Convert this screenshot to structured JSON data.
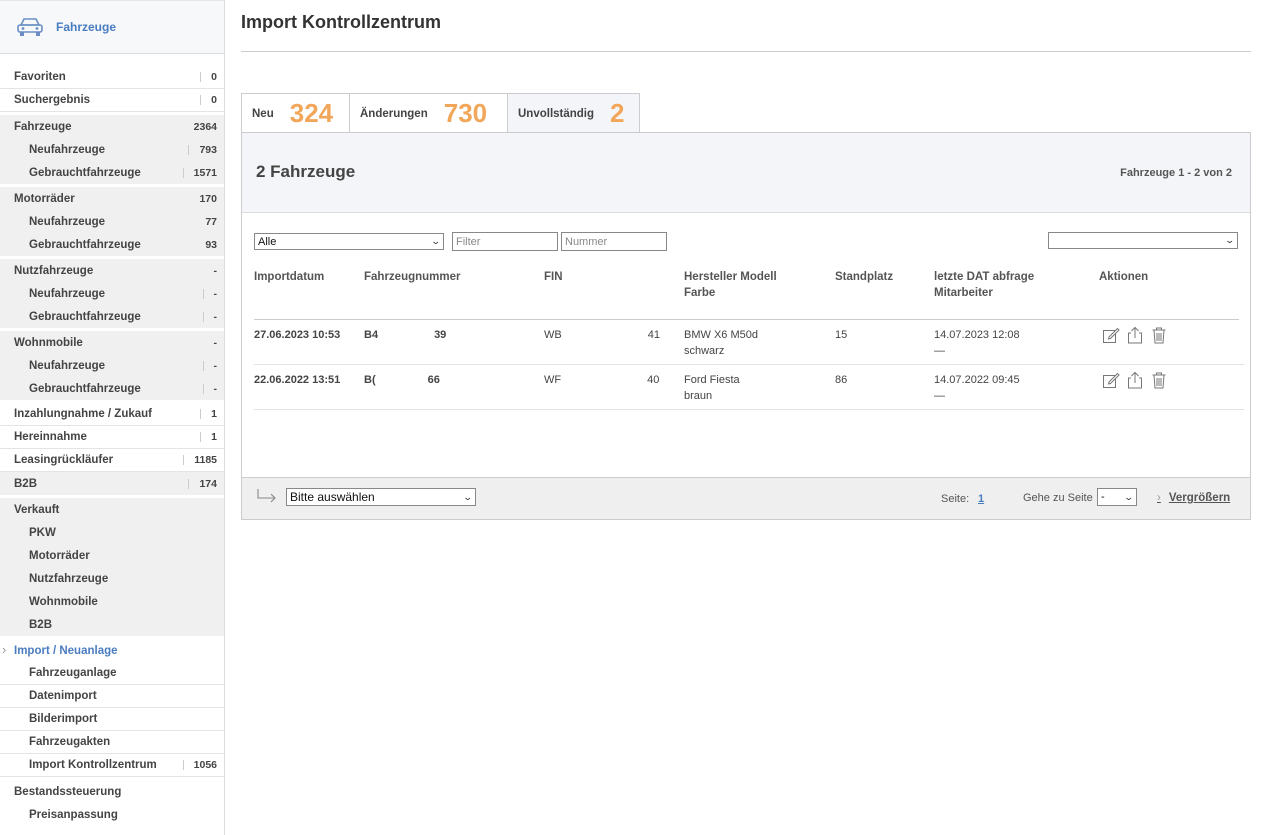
{
  "sidebar": {
    "header_title": "Fahrzeuge",
    "items": [
      {
        "label": "Favoriten",
        "count": "0",
        "level": 0,
        "style": "sep",
        "bar": true
      },
      {
        "label": "Suchergebnis",
        "count": "0",
        "level": 0,
        "style": "sep",
        "bar": true
      },
      {
        "label": "Fahrzeuge",
        "count": "2364",
        "level": 0,
        "style": "grey",
        "bar": false
      },
      {
        "label": "Neufahrzeuge",
        "count": "793",
        "level": 1,
        "style": "grey",
        "bar": true
      },
      {
        "label": "Gebrauchtfahrzeuge",
        "count": "1571",
        "level": 1,
        "style": "grey",
        "bar": true
      },
      {
        "label": "Motorräder",
        "count": "170",
        "level": 0,
        "style": "grey",
        "bar": false
      },
      {
        "label": "Neufahrzeuge",
        "count": "77",
        "level": 1,
        "style": "grey",
        "bar": false
      },
      {
        "label": "Gebrauchtfahrzeuge",
        "count": "93",
        "level": 1,
        "style": "grey",
        "bar": false
      },
      {
        "label": "Nutzfahrzeuge",
        "count": "-",
        "level": 0,
        "style": "grey",
        "bar": false
      },
      {
        "label": "Neufahrzeuge",
        "count": "-",
        "level": 1,
        "style": "grey",
        "bar": true
      },
      {
        "label": "Gebrauchtfahrzeuge",
        "count": "-",
        "level": 1,
        "style": "grey",
        "bar": true
      },
      {
        "label": "Wohnmobile",
        "count": "-",
        "level": 0,
        "style": "grey",
        "bar": false
      },
      {
        "label": "Neufahrzeuge",
        "count": "-",
        "level": 1,
        "style": "grey",
        "bar": true
      },
      {
        "label": "Gebrauchtfahrzeuge",
        "count": "-",
        "level": 1,
        "style": "grey",
        "bar": true
      },
      {
        "label": "Inzahlungnahme / Zukauf",
        "count": "1",
        "level": 0,
        "style": "sep",
        "bar": true
      },
      {
        "label": "Hereinnahme",
        "count": "1",
        "level": 0,
        "style": "sep",
        "bar": true
      },
      {
        "label": "Leasingrückläufer",
        "count": "1185",
        "level": 0,
        "style": "sep",
        "bar": true
      },
      {
        "label": "B2B",
        "count": "174",
        "level": 0,
        "style": "grey",
        "bar": true
      },
      {
        "label": "Verkauft",
        "count": "",
        "level": 0,
        "style": "grey",
        "bar": false
      },
      {
        "label": "PKW",
        "count": "",
        "level": 1,
        "style": "grey",
        "bar": false
      },
      {
        "label": "Motorräder",
        "count": "",
        "level": 1,
        "style": "grey",
        "bar": false
      },
      {
        "label": "Nutzfahrzeuge",
        "count": "",
        "level": 1,
        "style": "grey",
        "bar": false
      },
      {
        "label": "Wohnmobile",
        "count": "",
        "level": 1,
        "style": "grey",
        "bar": false
      },
      {
        "label": "B2B",
        "count": "",
        "level": 1,
        "style": "grey",
        "bar": false
      },
      {
        "label": "Import / Neuanlage",
        "count": "",
        "level": 0,
        "style": "active",
        "bar": false
      },
      {
        "label": "Fahrzeuganlage",
        "count": "",
        "level": 1,
        "style": "sep",
        "bar": false
      },
      {
        "label": "Datenimport",
        "count": "",
        "level": 1,
        "style": "sep",
        "bar": false
      },
      {
        "label": "Bilderimport",
        "count": "",
        "level": 1,
        "style": "sep",
        "bar": false
      },
      {
        "label": "Fahrzeugakten",
        "count": "",
        "level": 1,
        "style": "sep",
        "bar": false
      },
      {
        "label": "Import Kontrollzentrum",
        "count": "1056",
        "level": 1,
        "style": "sep",
        "bar": true
      },
      {
        "label": "Bestandssteuerung",
        "count": "",
        "level": 0,
        "style": "plain",
        "bar": false
      },
      {
        "label": "Preisanpassung",
        "count": "",
        "level": 1,
        "style": "plain",
        "bar": false
      }
    ]
  },
  "main": {
    "title": "Import Kontrollzentrum",
    "tabs": [
      {
        "label": "Neu",
        "count": "324"
      },
      {
        "label": "Änderungen",
        "count": "730"
      },
      {
        "label": "Unvollständig",
        "count": "2"
      }
    ],
    "vehicle_count": "2 Fahrzeuge",
    "range_text": "Fahrzeuge 1 - 2 von 2",
    "filters": {
      "category_value": "Alle",
      "filter_placeholder": "Filter",
      "number_placeholder": "Nummer",
      "right_select_value": ""
    },
    "columns": {
      "import_date": "Importdatum",
      "vehicle_number": "Fahrzeugnummer",
      "fin": "FIN",
      "make_model": "Hersteller Modell",
      "color": "Farbe",
      "location": "Standplatz",
      "dat_query": "letzte DAT abfrage",
      "employee": "Mitarbeiter",
      "actions": "Aktionen"
    },
    "rows": [
      {
        "import_date": "27.06.2023 10:53",
        "number_start": "B4",
        "number_end": "39",
        "fin_start": "WB",
        "fin_end": "41",
        "model": "BMW X6 M50d",
        "color": "schwarz",
        "location": "15",
        "dat_date": "14.07.2023 12:08",
        "employee": "—"
      },
      {
        "import_date": "22.06.2022 13:51",
        "number_start": "B(",
        "number_end": "66",
        "fin_start": "WF",
        "fin_end": "40",
        "model": "Ford Fiesta",
        "color": "braun",
        "location": "86",
        "dat_date": "14.07.2022 09:45",
        "employee": "—"
      }
    ],
    "footer": {
      "bulk_action_value": "Bitte auswählen",
      "page_label": "Seite:",
      "page_number": "1",
      "goto_label": "Gehe zu Seite",
      "goto_value": "-",
      "enlarge_label": "Vergrößern"
    }
  }
}
